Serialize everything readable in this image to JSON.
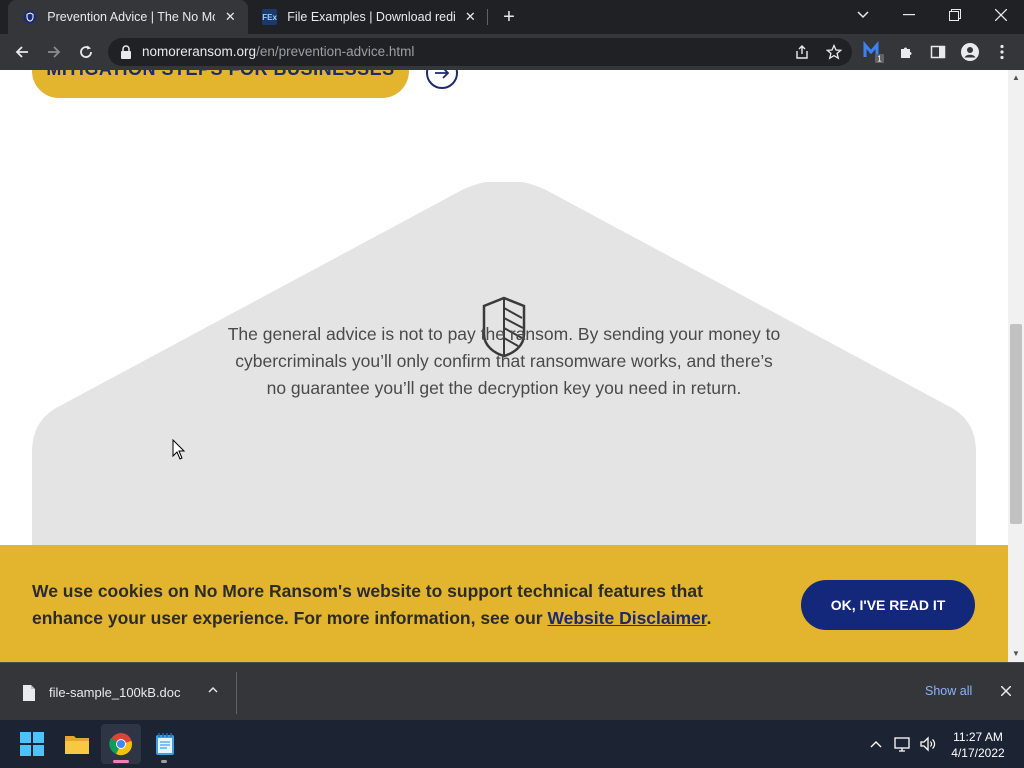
{
  "browser": {
    "tabs": [
      {
        "title": "Prevention Advice | The No More Ransom Project",
        "favicon": "shield-favicon",
        "active": true
      },
      {
        "title": "File Examples | Download redirect",
        "favicon": "FEx",
        "active": false
      }
    ],
    "url_host": "nomoreransom.org",
    "url_path": "/en/prevention-advice.html",
    "extension_badge": "1"
  },
  "page": {
    "mitigation_button": "MITIGATION STEPS FOR BUSINESSES",
    "advice_text": "The general advice is not to pay the ransom. By sending your money to cybercriminals you’ll only confirm that ransomware works, and there’s no guarantee you’ll get the decryption key you need in return.",
    "colors": {
      "accent_yellow": "#e3b52e",
      "navy": "#13287a",
      "card_grey": "#e4e4e4"
    }
  },
  "cookie_banner": {
    "text_before_link": "We use cookies on No More Ransom's website to support technical features that enhance your user experience. For more information, see our ",
    "link_text": "Website Disclaimer",
    "text_after_link": ".",
    "ok_button": "OK, I'VE READ IT"
  },
  "download_bar": {
    "filename": "file-sample_100kB.doc",
    "show_all": "Show all"
  },
  "taskbar": {
    "time": "11:27 AM",
    "date": "4/17/2022",
    "apps": [
      "windows-start",
      "file-explorer",
      "chrome",
      "notepad"
    ]
  }
}
